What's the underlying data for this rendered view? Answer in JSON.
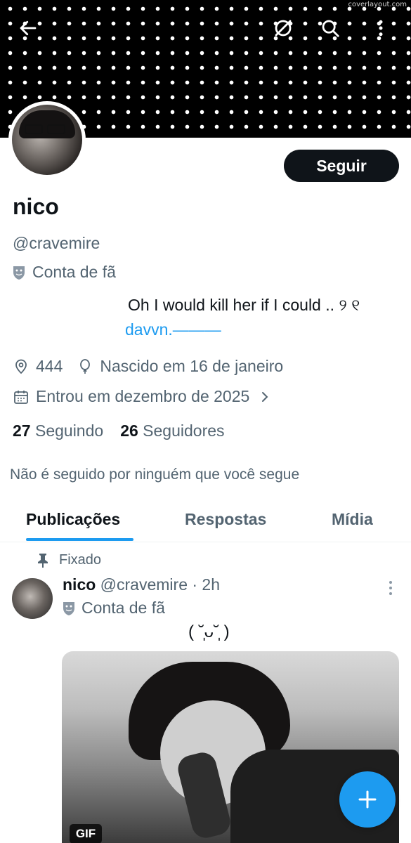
{
  "watermark": "coverlayout.com",
  "header": {
    "back_icon": "arrow-left-icon",
    "grok_icon": "grok-icon",
    "search_icon": "search-icon",
    "more_icon": "more-vertical-icon"
  },
  "profile": {
    "follow_label": "Seguir",
    "name": "nico",
    "handle": "@cravemire",
    "fan_label": "Conta de fã",
    "bio_line1": "Oh I would kill her if I could .. ୨ ୧",
    "bio_line2": "davvn.———",
    "location": "444",
    "birthday": "Nascido em 16 de janeiro",
    "joined": "Entrou em dezembro de 2025",
    "following_count": "27",
    "following_label": "Seguindo",
    "followers_count": "26",
    "followers_label": "Seguidores",
    "not_followed": "Não é seguido por ninguém que você segue"
  },
  "tabs": [
    {
      "label": "Publicações",
      "active": true
    },
    {
      "label": "Respostas",
      "active": false
    },
    {
      "label": "Mídia",
      "active": false
    }
  ],
  "post": {
    "pinned_label": "Fixado",
    "name": "nico",
    "meta": "@cravemire · 2h",
    "fan_label": "Conta de fã",
    "text": "( ˘̩ᴗ˘̩ )",
    "gif_label": "GIF"
  },
  "fab_icon": "compose-plus-icon",
  "colors": {
    "accent": "#1d9bf0",
    "text": "#0f1419",
    "secondary": "#536471"
  }
}
